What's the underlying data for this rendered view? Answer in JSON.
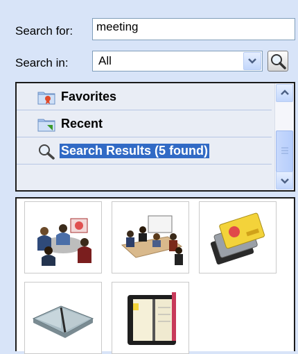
{
  "search": {
    "label": "Search for:",
    "value": "meeting"
  },
  "scope": {
    "label": "Search in:",
    "value": "All"
  },
  "tree": {
    "items": [
      {
        "label": "Favorites",
        "icon": "favorites-folder-icon"
      },
      {
        "label": "Recent",
        "icon": "recent-folder-icon"
      },
      {
        "label": "Search Results (5 found)",
        "icon": "magnifier-icon",
        "selected": true
      }
    ]
  },
  "results": [
    {
      "icon": "business-meeting-clipart"
    },
    {
      "icon": "conference-table-clipart"
    },
    {
      "icon": "credit-cards-clipart"
    },
    {
      "icon": "open-book-clipart"
    },
    {
      "icon": "organizer-planner-clipart"
    }
  ],
  "colors": {
    "panel_bg": "#d8e4f8",
    "selection": "#316ac5",
    "field_border": "#7f9db9"
  }
}
